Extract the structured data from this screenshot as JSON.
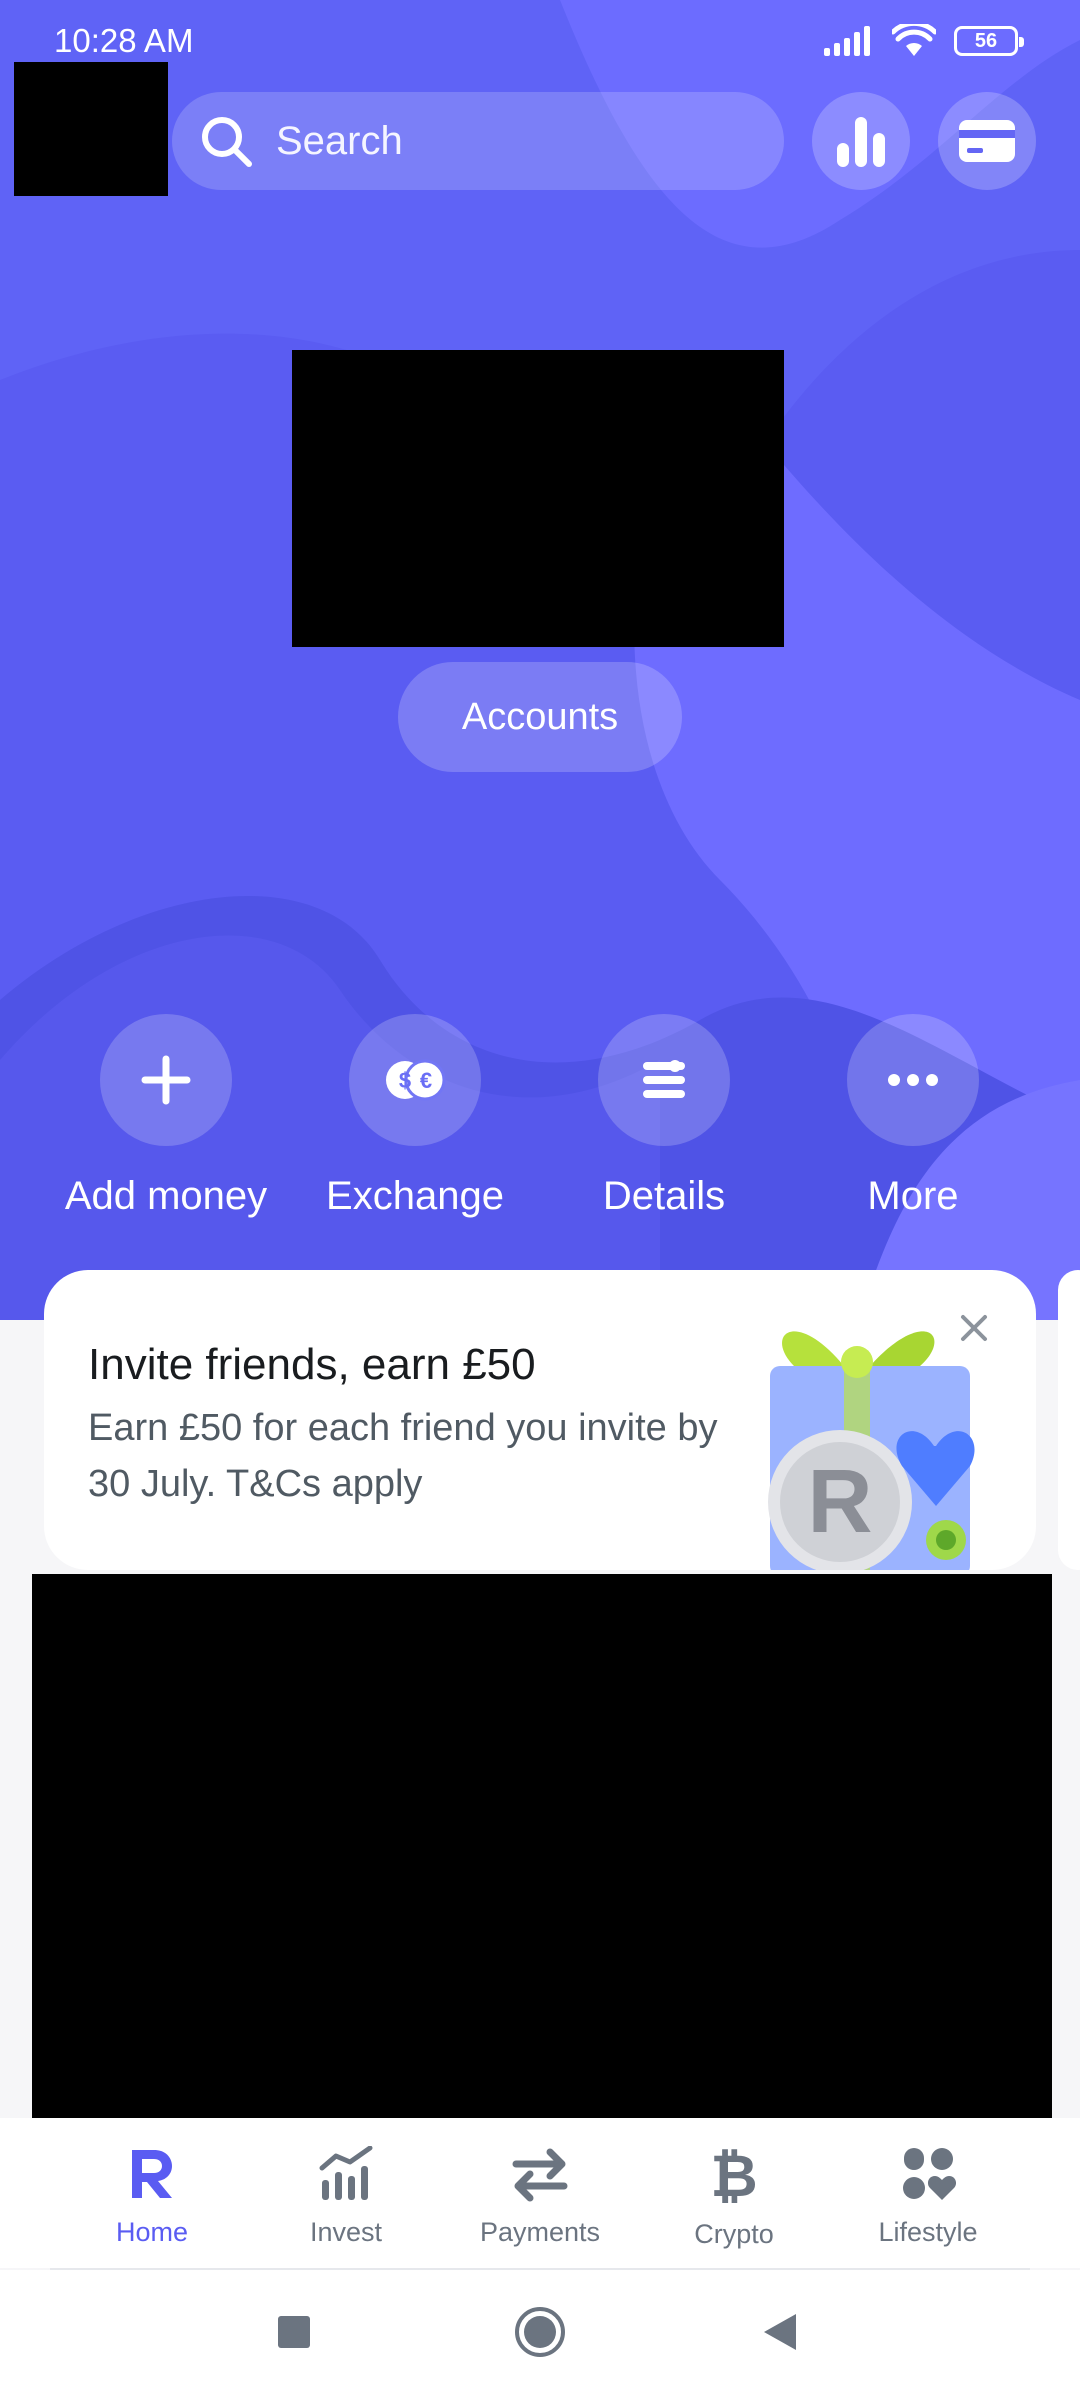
{
  "status_bar": {
    "time": "10:28 AM",
    "battery": "56"
  },
  "header": {
    "search_placeholder": "Search"
  },
  "balance": {
    "accounts_label": "Accounts"
  },
  "actions": [
    {
      "label": "Add money",
      "icon": "plus-icon"
    },
    {
      "label": "Exchange",
      "icon": "exchange-icon"
    },
    {
      "label": "Details",
      "icon": "details-icon"
    },
    {
      "label": "More",
      "icon": "more-icon"
    }
  ],
  "promo": {
    "title": "Invite friends, earn £50",
    "description": "Earn £50 for each friend you invite by 30 July. T&Cs apply"
  },
  "bottom_nav": [
    {
      "label": "Home",
      "icon": "revolut-r-icon",
      "active": true
    },
    {
      "label": "Invest",
      "icon": "invest-chart-icon",
      "active": false
    },
    {
      "label": "Payments",
      "icon": "transfer-arrows-icon",
      "active": false
    },
    {
      "label": "Crypto",
      "icon": "bitcoin-icon",
      "active": false
    },
    {
      "label": "Lifestyle",
      "icon": "lifestyle-icon",
      "active": false
    }
  ],
  "colors": {
    "accent": "#5a5cf2",
    "hero_light": "#7a78ff",
    "nav_inactive": "#6b7480"
  }
}
